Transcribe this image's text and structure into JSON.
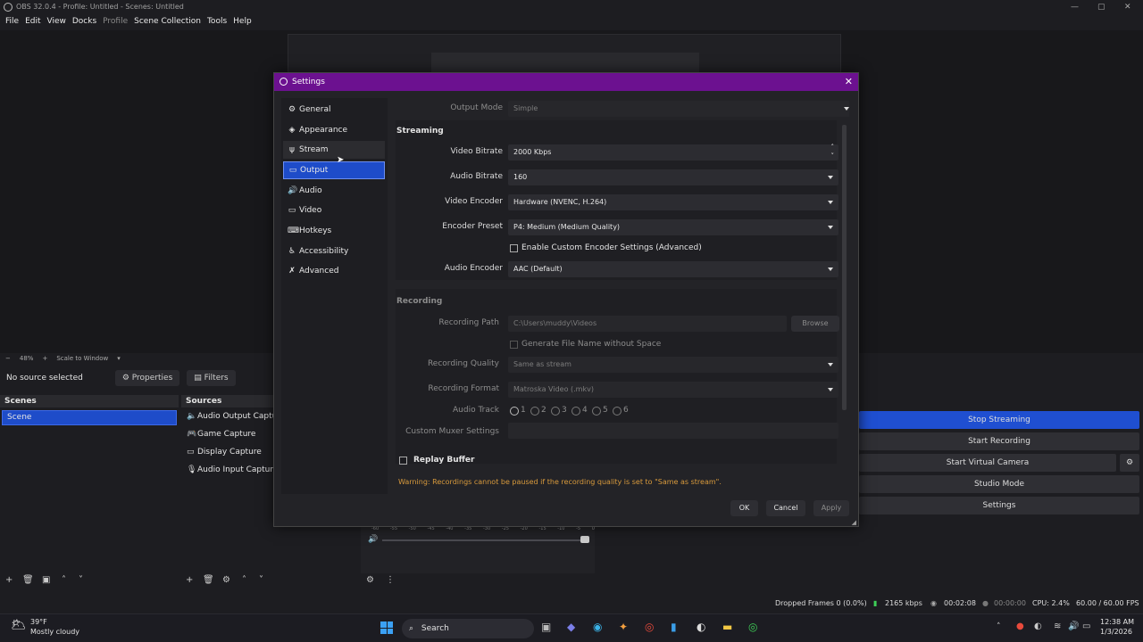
{
  "main_window": {
    "title": "OBS 32.0.4 - Profile: Untitled - Scenes: Untitled",
    "menu": [
      "File",
      "Edit",
      "View",
      "Docks",
      "Profile",
      "Scene Collection",
      "Tools",
      "Help"
    ],
    "zoom": "48%",
    "scale_mode": "Scale to Window",
    "no_source": "No source selected",
    "properties_label": "Properties",
    "filters_label": "Filters"
  },
  "scenes": {
    "title": "Scenes",
    "items": [
      "Scene"
    ]
  },
  "sources": {
    "title": "Sources",
    "items": [
      {
        "label": "Audio Output Capture",
        "icon": "speaker-icon"
      },
      {
        "label": "Game Capture",
        "icon": "gamepad-icon"
      },
      {
        "label": "Display Capture",
        "icon": "monitor-icon"
      },
      {
        "label": "Audio Input Capture",
        "icon": "microphone-icon"
      }
    ]
  },
  "controls": {
    "stop_streaming": "Stop Streaming",
    "start_recording": "Start Recording",
    "start_virtual_camera": "Start Virtual Camera",
    "studio_mode": "Studio Mode",
    "settings": "Settings"
  },
  "mixer_ticks": [
    "-60",
    "-55",
    "-50",
    "-45",
    "-40",
    "-35",
    "-30",
    "-25",
    "-20",
    "-15",
    "-10",
    "-5",
    "0"
  ],
  "statusbar": {
    "dropped_frames": "Dropped Frames 0 (0.0%)",
    "bitrate": "2165 kbps",
    "stream_time": "00:02:08",
    "rec_time": "00:00:00",
    "cpu": "CPU: 2.4%",
    "fps": "60.00 / 60.00 FPS"
  },
  "taskbar": {
    "weather_temp": "39°F",
    "weather_desc": "Mostly cloudy",
    "search": "Search",
    "time": "12:38 AM",
    "date": "1/3/2026"
  },
  "settings": {
    "title": "Settings",
    "nav": [
      {
        "label": "General",
        "icon": "gear-icon"
      },
      {
        "label": "Appearance",
        "icon": "palette-icon"
      },
      {
        "label": "Stream",
        "icon": "antenna-icon"
      },
      {
        "label": "Output",
        "icon": "output-icon"
      },
      {
        "label": "Audio",
        "icon": "speaker-icon"
      },
      {
        "label": "Video",
        "icon": "monitor-icon"
      },
      {
        "label": "Hotkeys",
        "icon": "keyboard-icon"
      },
      {
        "label": "Accessibility",
        "icon": "accessibility-icon"
      },
      {
        "label": "Advanced",
        "icon": "wrench-icon"
      }
    ],
    "selected_nav": "Output",
    "output_mode_label": "Output Mode",
    "output_mode_value": "Simple",
    "streaming": {
      "title": "Streaming",
      "video_bitrate_label": "Video Bitrate",
      "video_bitrate_value": "2000 Kbps",
      "audio_bitrate_label": "Audio Bitrate",
      "audio_bitrate_value": "160",
      "video_encoder_label": "Video Encoder",
      "video_encoder_value": "Hardware (NVENC, H.264)",
      "encoder_preset_label": "Encoder Preset",
      "encoder_preset_value": "P4: Medium (Medium Quality)",
      "custom_encoder_label": "Enable Custom Encoder Settings (Advanced)",
      "audio_encoder_label": "Audio Encoder",
      "audio_encoder_value": "AAC (Default)"
    },
    "recording": {
      "title": "Recording",
      "path_label": "Recording Path",
      "path_value": "C:\\Users\\muddy\\Videos",
      "browse": "Browse",
      "no_space_label": "Generate File Name without Space",
      "quality_label": "Recording Quality",
      "quality_value": "Same as stream",
      "format_label": "Recording Format",
      "format_value": "Matroska Video (.mkv)",
      "track_label": "Audio Track",
      "tracks": [
        "1",
        "2",
        "3",
        "4",
        "5",
        "6"
      ],
      "muxer_label": "Custom Muxer Settings",
      "muxer_value": ""
    },
    "replay_buffer": "Replay Buffer",
    "warning": "Warning: Recordings cannot be paused if the recording quality is set to \"Same as stream\".",
    "ok": "OK",
    "cancel": "Cancel",
    "apply": "Apply",
    "colors": {
      "title_bar": "#6c1190",
      "selection": "#1e4cc9",
      "warning": "#d89a3c"
    }
  }
}
